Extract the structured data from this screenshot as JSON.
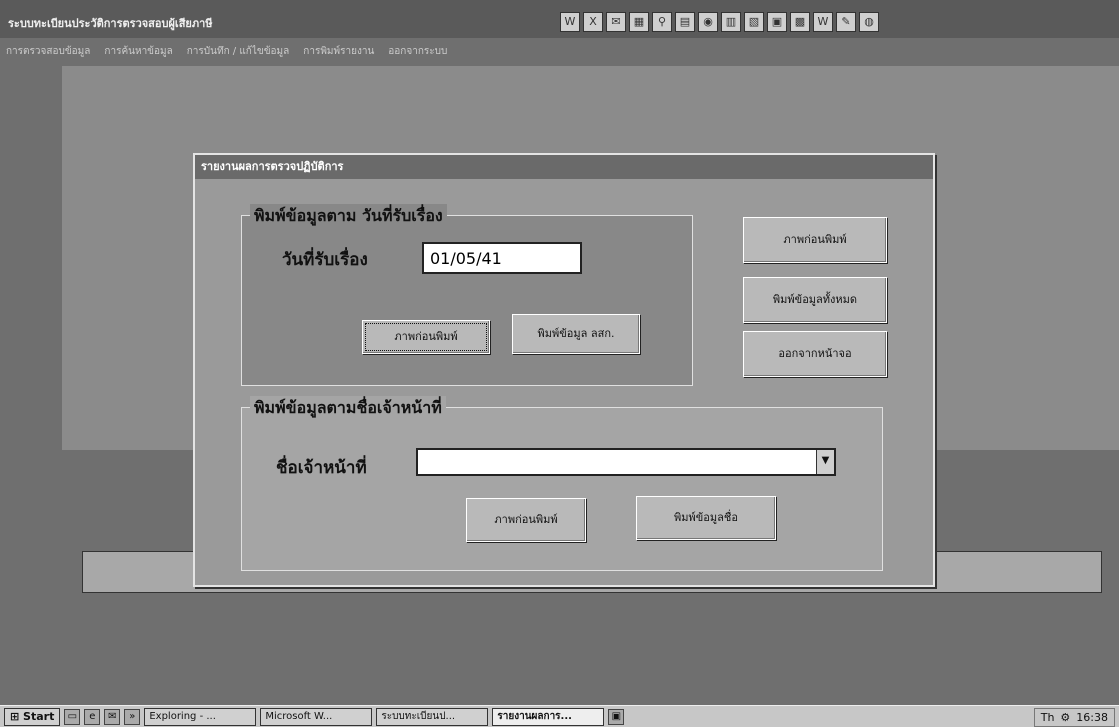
{
  "app": {
    "title": "ระบบทะเบียนประวัติการตรวจสอบผู้เสียภาษี",
    "menu": [
      "การตรวจสอบข้อมูล",
      "การค้นหาข้อมูล",
      "การบันทึก / แก้ไขข้อมูล",
      "การพิมพ์รายงาน",
      "ออกจากระบบ"
    ]
  },
  "toolbar_icons": [
    "word-icon",
    "excel-icon",
    "mail-icon",
    "calendar-icon",
    "search-icon",
    "doc-icon",
    "web-icon",
    "chart-icon",
    "notes-icon",
    "folder-icon",
    "book-icon",
    "word2-icon",
    "pen-icon",
    "globe-icon"
  ],
  "dialog": {
    "title": "รายงานผลการตรวจปฏิบัติการ",
    "group_date": {
      "label": "พิมพ์ข้อมูลตาม วันที่รับเรื่อง",
      "field_label": "วันที่รับเรื่อง",
      "date_value": "01/05/41",
      "preview_label": "ภาพก่อนพิมพ์",
      "print_label": "พิมพ์ข้อมูล ลสก."
    },
    "side": {
      "preview_label": "ภาพก่อนพิมพ์",
      "print_all_label": "พิมพ์ข้อมูลทั้งหมด",
      "exit_label": "ออกจากหน้าจอ"
    },
    "group_officer": {
      "label": "พิมพ์ข้อมูลตามชื่อเจ้าหน้าที่",
      "field_label": "ชื่อเจ้าหน้าที่",
      "officer_value": "",
      "preview_label": "ภาพก่อนพิมพ์",
      "print_label": "พิมพ์ข้อมูลชื่อ"
    }
  },
  "taskbar": {
    "start_label": "Start",
    "tasks": [
      "Exploring - ...",
      "Microsoft W...",
      "ระบบทะเบียนป...",
      "รายงานผลการ..."
    ],
    "clock": "16:38"
  }
}
